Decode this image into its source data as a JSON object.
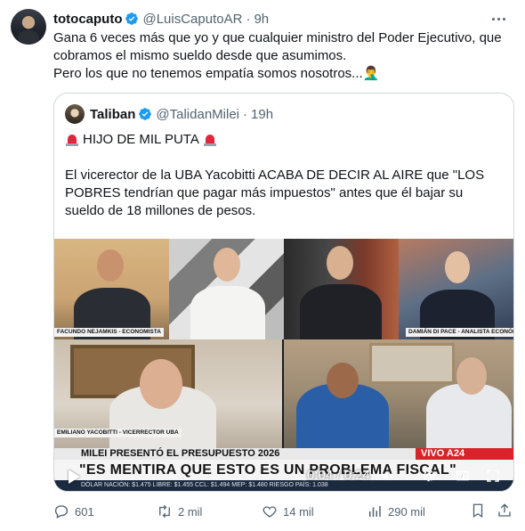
{
  "post": {
    "display_name": "totocaputo",
    "handle": "@LuisCaputoAR",
    "separator": "·",
    "time": "9h",
    "text_lines": [
      "Gana 6 veces más que yo y que cualquier ministro del Poder Ejecutivo, que",
      "cobramos el mismo sueldo desde que asumimos.",
      "Pero los que no tenemos empatía somos nosotros...🤦‍♂️"
    ]
  },
  "quote": {
    "display_name": "Taliban",
    "handle": "@TalidanMilei",
    "separator": "·",
    "time": "19h",
    "headline": "HIJO DE MIL PUTA",
    "body_lines": [
      "El vicerector de la UBA Yacobitti ACABA DE DECIR AL AIRE que \"LOS",
      "POBRES tendrían que pagar más impuestos\" antes que él bajar su",
      "sueldo de 18 millones de pesos."
    ]
  },
  "video": {
    "lower_thirds": [
      "FACUNDO NEJAMKIS - ECONOMISTA",
      "DAMIÁN DI PACE - ANALISTA ECONÓMICO",
      "EMILIANO YACOBITTI - VICERRECTOR UBA"
    ],
    "ticker_top": "MILEI PRESENTÓ EL PRESUPUESTO 2026",
    "channel": "VIVO A24",
    "ticker_main": "\"ES MENTIRA QUE ESTO ES UN PROBLEMA FISCAL\"",
    "ticker_bottom": "DÓLAR     NACIÓN: $1.475     LIBRE: $1.455     CCL: $1.494     MEP: $1.480     RIESGO PAÍS: 1.038",
    "timecode": "0:04 / 0:24",
    "progress_fraction": 0.17
  },
  "actions": {
    "replies": "601",
    "reposts": "2 mil",
    "likes": "14 mil",
    "views": "290 mil"
  },
  "colors": {
    "verified": "#1d9bf0",
    "text_primary": "#0f1419",
    "text_secondary": "#536471",
    "border": "#cfd9de",
    "a24_red": "#d8232a"
  }
}
